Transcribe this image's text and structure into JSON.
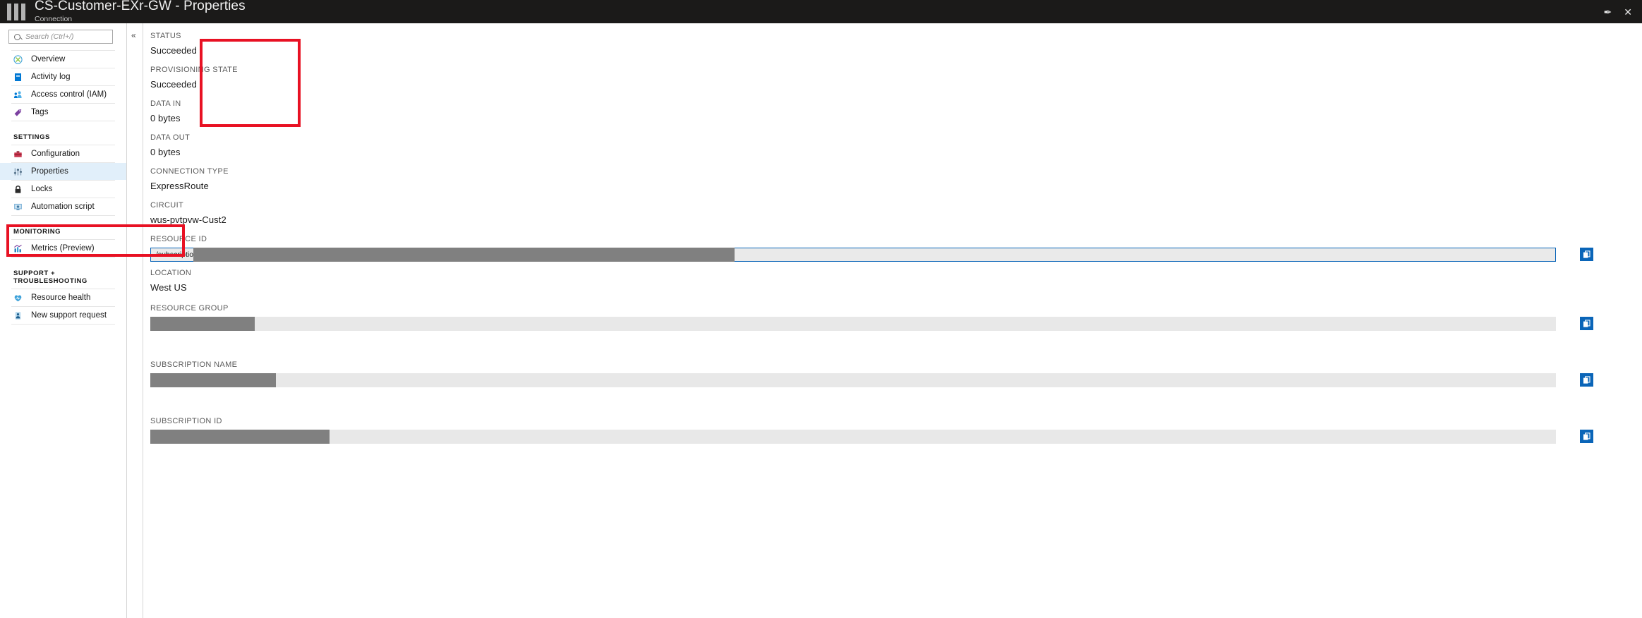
{
  "titlebar": {
    "title": "CS-Customer-EXr-GW - Properties",
    "subtitle": "Connection",
    "pin_label": "✒",
    "close_label": "✕"
  },
  "search": {
    "placeholder": "Search (Ctrl+/)"
  },
  "collapse": {
    "label": "«"
  },
  "sidebar": {
    "items": [
      {
        "label": "Overview",
        "icon": "overview-icon",
        "selected": false
      },
      {
        "label": "Activity log",
        "icon": "activity-log-icon",
        "selected": false
      },
      {
        "label": "Access control (IAM)",
        "icon": "access-control-icon",
        "selected": false
      },
      {
        "label": "Tags",
        "icon": "tags-icon",
        "selected": false
      }
    ],
    "groups": [
      {
        "title": "SETTINGS",
        "items": [
          {
            "label": "Configuration",
            "icon": "configuration-icon",
            "selected": false
          },
          {
            "label": "Properties",
            "icon": "properties-icon",
            "selected": true
          },
          {
            "label": "Locks",
            "icon": "locks-icon",
            "selected": false
          },
          {
            "label": "Automation script",
            "icon": "automation-script-icon",
            "selected": false
          }
        ]
      },
      {
        "title": "MONITORING",
        "items": [
          {
            "label": "Metrics (Preview)",
            "icon": "metrics-icon",
            "selected": false
          }
        ]
      },
      {
        "title": "SUPPORT + TROUBLESHOOTING",
        "items": [
          {
            "label": "Resource health",
            "icon": "resource-health-icon",
            "selected": false
          },
          {
            "label": "New support request",
            "icon": "new-support-request-icon",
            "selected": false
          }
        ]
      }
    ]
  },
  "properties": {
    "status": {
      "label": "STATUS",
      "value": "Succeeded"
    },
    "provisioning_state": {
      "label": "PROVISIONING STATE",
      "value": "Succeeded"
    },
    "data_in": {
      "label": "DATA IN",
      "value": "0 bytes"
    },
    "data_out": {
      "label": "DATA OUT",
      "value": "0 bytes"
    },
    "connection_type": {
      "label": "CONNECTION TYPE",
      "value": "ExpressRoute"
    },
    "circuit": {
      "label": "CIRCUIT",
      "value": "wus-pvtpvw-Cust2"
    },
    "resource_id": {
      "label": "RESOURCE ID",
      "value": "/subscriptions"
    },
    "location": {
      "label": "LOCATION",
      "value": "West US"
    },
    "resource_group": {
      "label": "RESOURCE GROUP",
      "value": ""
    },
    "subscription_name": {
      "label": "SUBSCRIPTION NAME",
      "value": ""
    },
    "subscription_id": {
      "label": "SUBSCRIPTION ID",
      "value": ""
    }
  },
  "colors": {
    "titlebar_bg": "#1b1a19",
    "annotation_red": "#e81123",
    "accent_blue": "#0a65b8",
    "selected_bg": "#e1effa",
    "redaction_gray": "#808080"
  }
}
